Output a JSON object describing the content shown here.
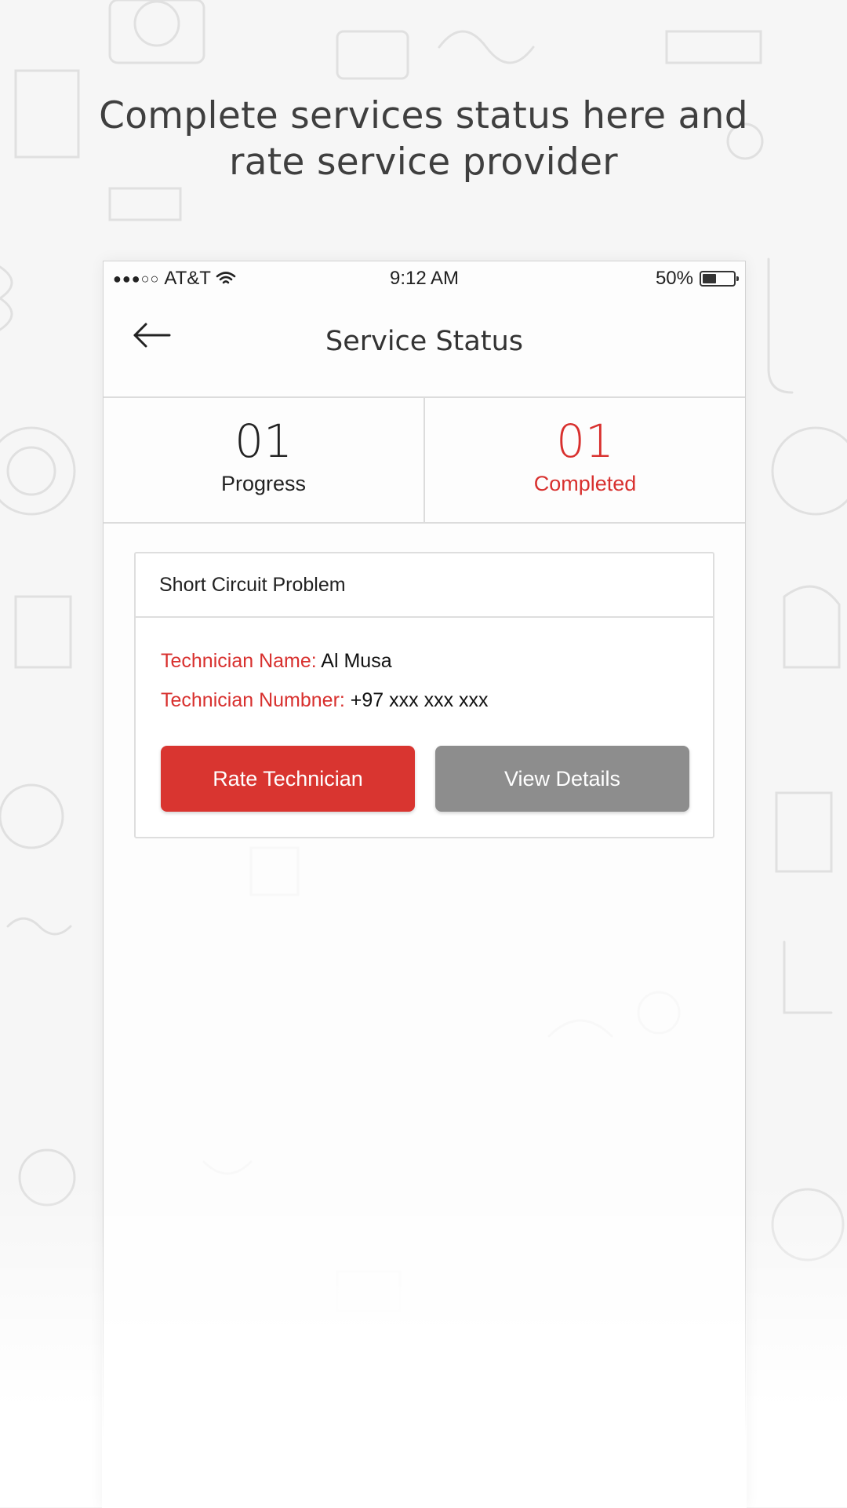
{
  "headline": {
    "line1": "Complete services status here and",
    "line2": "rate service provider"
  },
  "status_bar": {
    "carrier": "AT&T",
    "time": "9:12 AM",
    "battery_percent_label": "50%",
    "battery_level": 0.5,
    "signal_icon": "signal-dots-icon",
    "wifi_icon": "wifi-icon"
  },
  "nav": {
    "back_icon": "back-arrow-icon",
    "title": "Service Status"
  },
  "stats": [
    {
      "count": "01",
      "label": "Progress",
      "active": false
    },
    {
      "count": "01",
      "label": "Completed",
      "active": true
    }
  ],
  "service": {
    "title": "Short Circuit Problem",
    "technician_name_label": "Technician Name:",
    "technician_name": "Al Musa",
    "technician_number_label": "Technician Numbner:",
    "technician_number": "+97 xxx xxx xxx",
    "rate_button": "Rate Technician",
    "details_button": "View Details"
  },
  "colors": {
    "accent": "#d8302e",
    "secondary_button": "#8d8d8d",
    "headline_text": "#3f3f3f"
  }
}
